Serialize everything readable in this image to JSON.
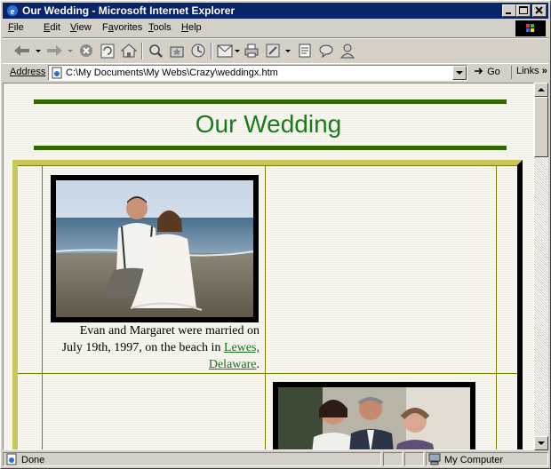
{
  "window": {
    "title": "Our Wedding - Microsoft Internet Explorer",
    "controls": [
      "minimize",
      "maximize",
      "close"
    ]
  },
  "menu": {
    "items": [
      {
        "label": "File",
        "key": "F",
        "rest": "ile"
      },
      {
        "label": "Edit",
        "key": "E",
        "rest": "dit"
      },
      {
        "label": "View",
        "key": "V",
        "rest": "iew"
      },
      {
        "label": "Favorites",
        "key": "a",
        "pre": "F",
        "rest": "vorites"
      },
      {
        "label": "Tools",
        "key": "T",
        "rest": "ools"
      },
      {
        "label": "Help",
        "key": "H",
        "rest": "elp"
      }
    ]
  },
  "toolbar": {
    "buttons": [
      "back-icon",
      "forward-icon",
      "stop-icon",
      "refresh-icon",
      "home-icon",
      "search-icon",
      "favorites-icon",
      "history-icon",
      "mail-icon",
      "print-icon",
      "edit-icon",
      "discuss-icon",
      "messenger-icon",
      "user-icon"
    ]
  },
  "address": {
    "label": "Address",
    "url": "C:\\My Documents\\My Webs\\Crazy\\weddingx.htm",
    "go_label": "Go",
    "links_label": "Links"
  },
  "page": {
    "title": "Our Wedding",
    "caption_text1": "Evan and Margaret were married on July 19th, 1997, on the beach in ",
    "caption_link": "Lewes, Delaware",
    "caption_end": ".",
    "colors": {
      "title": "#1b7a1b",
      "rule": "#336600",
      "table_border": "#c8c85a"
    }
  },
  "status": {
    "text": "Done",
    "zone": "My Computer"
  }
}
